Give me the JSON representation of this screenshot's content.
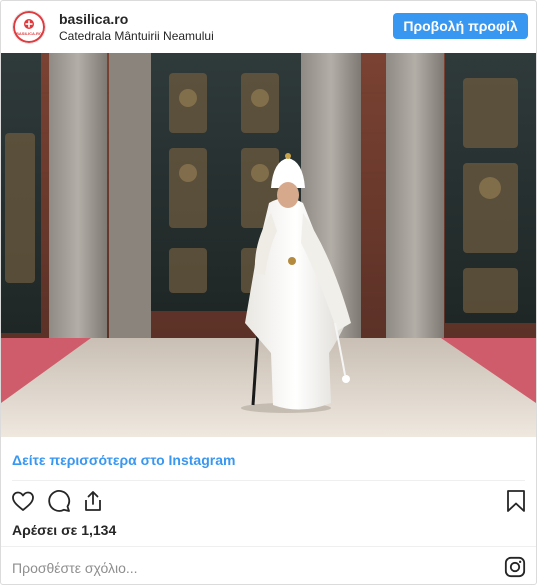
{
  "header": {
    "avatar_text": "BASILICA.RO",
    "username": "basilica.ro",
    "location": "Catedrala Mântuirii Neamului",
    "view_profile_label": "Προβολή προφίλ"
  },
  "post": {
    "image_alt": "Patriarch in white vestments walking with a staff on a carpet inside a cathedral",
    "see_more_label": "Δείτε περισσότερα στο Instagram",
    "likes_label": "Αρέσει σε 1,134",
    "comment_placeholder": "Προσθέστε σχόλιο..."
  },
  "icons": [
    "heart-icon",
    "comment-icon",
    "share-icon",
    "bookmark-icon",
    "instagram-icon"
  ],
  "colors": {
    "accent": "#3897f0",
    "text": "#262626",
    "muted": "#8e8e8e",
    "divider": "#efefef",
    "brand_red": "#e03a3e"
  }
}
